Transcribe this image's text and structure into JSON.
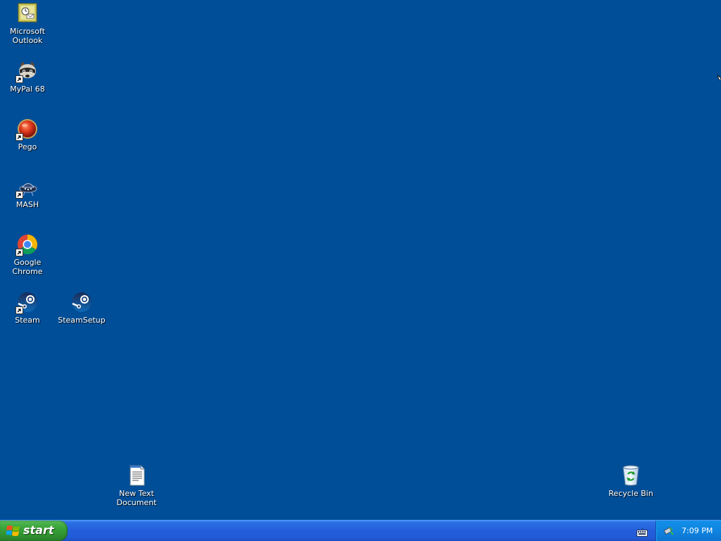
{
  "desktop": {
    "background_color": "#004e98",
    "icons": {
      "outlook": {
        "label": "Microsoft\nOutlook",
        "icon": "outlook-icon"
      },
      "mypal": {
        "label": "MyPal 68",
        "icon": "raccoon-icon"
      },
      "pego": {
        "label": "Pego",
        "icon": "red-ball-icon"
      },
      "mash": {
        "label": "MASH",
        "icon": "mash-icon"
      },
      "chrome": {
        "label": "Google Chrome",
        "icon": "chrome-icon"
      },
      "steam": {
        "label": "Steam",
        "icon": "steam-icon"
      },
      "steamsetup": {
        "label": "SteamSetup",
        "icon": "steam-icon"
      },
      "textdoc": {
        "label": "New Text\nDocument",
        "icon": "text-document-icon"
      },
      "recycle": {
        "label": "Recycle Bin",
        "icon": "recycle-bin-icon"
      }
    }
  },
  "taskbar": {
    "start_label": "start",
    "clock": "7:09 PM",
    "colors": {
      "taskbar": "#245edb",
      "start": "#3aa53a",
      "tray": "#0f84e0"
    }
  }
}
